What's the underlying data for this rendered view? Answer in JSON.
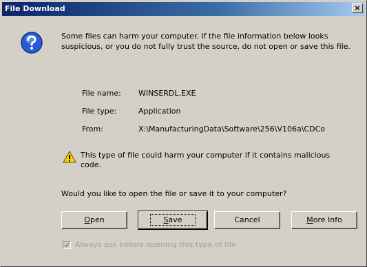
{
  "window": {
    "title": "File Download",
    "close_glyph": "×"
  },
  "message": {
    "intro": "Some files can harm your computer. If the file information below looks suspicious, or you do not fully trust the source, do not open or save this file.",
    "icon": "question-icon"
  },
  "file_info": {
    "name_label": "File name:",
    "name_value": "WINSERDL.EXE",
    "type_label": "File type:",
    "type_value": "Application",
    "from_label": "From:",
    "from_value": "X:\\ManufacturingData\\Software\\256\\V106a\\CDCo"
  },
  "warning": {
    "icon": "warning-icon",
    "text": "This type of file could harm your computer if it contains malicious code."
  },
  "question": "Would you like to open the file or save it to your computer?",
  "buttons": {
    "open": {
      "mnemonic": "O",
      "rest": "pen"
    },
    "save": {
      "mnemonic": "S",
      "rest": "ave"
    },
    "cancel": "Cancel",
    "more_info": {
      "mnemonic": "M",
      "rest": "ore Info"
    }
  },
  "always_ask": {
    "label": "Always ask before opening this type of file",
    "checked": true
  },
  "colors": {
    "title_gradient_start": "#0a246a",
    "title_gradient_end": "#a6caf0",
    "face": "#d4d0c8"
  }
}
